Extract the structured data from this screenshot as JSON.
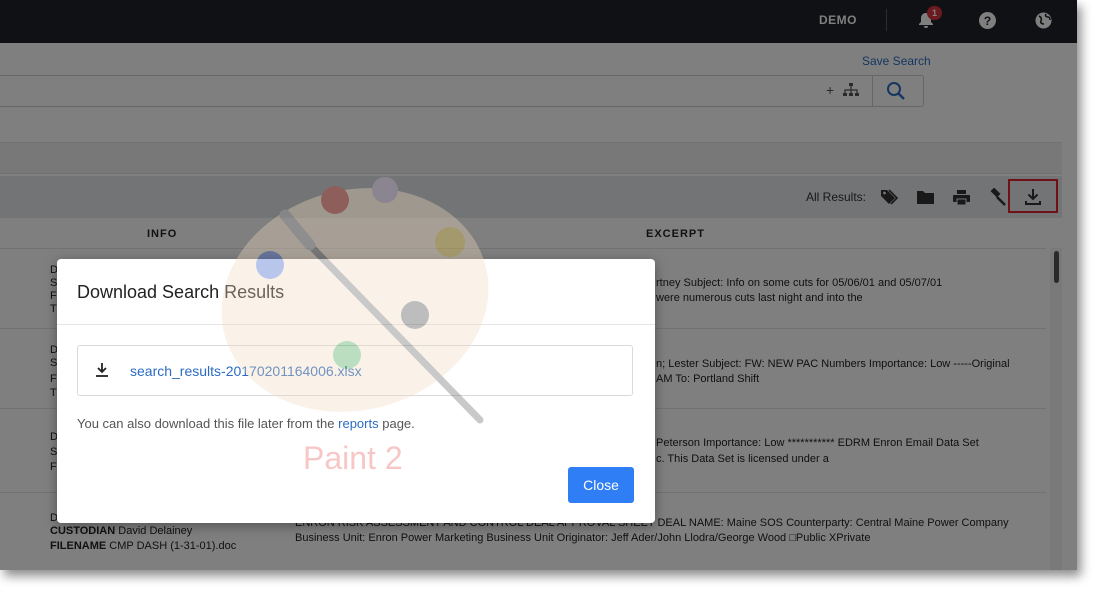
{
  "topbar": {
    "user": "DEMO",
    "notification_count": "1"
  },
  "search": {
    "save_label": "Save Search",
    "plus": "+"
  },
  "toolbar": {
    "all_results_label": "All Results:"
  },
  "columns": {
    "info": "INFO",
    "excerpt": "EXCERPT"
  },
  "rows": [
    {
      "letters": [
        "D",
        "S",
        "F",
        "T"
      ],
      "excerpt": [
        "rtney Subject: Info on some cuts for 05/06/01 and 05/07/01",
        "were numerous cuts last night and into the"
      ]
    },
    {
      "letters": [
        "D",
        "S",
        "F",
        "T"
      ],
      "excerpt": [
        "n; Lester Subject: FW: NEW PAC Numbers Importance: Low -----Original",
        "AM To: Portland Shift"
      ]
    },
    {
      "letters": [
        "D",
        "S",
        "F"
      ],
      "excerpt": [
        "Peterson Importance: Low *********** EDRM Enron Email Data Set",
        "c. This Data Set is licensed under a"
      ]
    },
    {
      "d": "D",
      "custodian_label": "CUSTODIAN",
      "custodian": "David Delainey",
      "filename_label": "FILENAME",
      "filename": "CMP DASH (1-31-01).doc",
      "excerpt": [
        "ENRON RISK ASSESSMENT AND CONTROL DEAL APPROVAL SHEET DEAL NAME: Maine SOS Counterparty: Central Maine Power Company",
        "Business Unit: Enron Power Marketing Business Unit Originator: Jeff Ader/John Llodra/George Wood □Public XPrivate"
      ]
    }
  ],
  "watermark": {
    "text": "Paint 2"
  },
  "modal": {
    "title": "Download Search Results",
    "filename": "search_results-20170201164006.xlsx",
    "note_prefix": "You can also download this file later from the",
    "note_link": "reports",
    "note_suffix": "page.",
    "close_label": "Close"
  },
  "colors": {
    "accent": "#2f7ef5",
    "link": "#2b6cc2",
    "highlight": "#e0222f",
    "topbar": "#1f2329"
  }
}
